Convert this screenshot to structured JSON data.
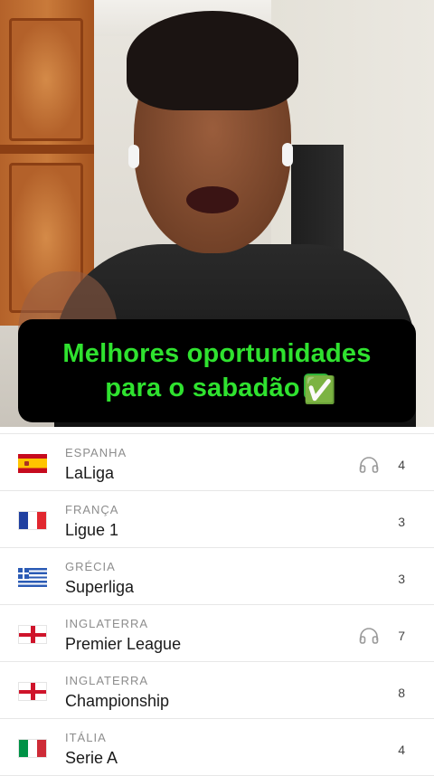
{
  "caption": {
    "line1": "Melhores oportunidades",
    "line2": "para o sabadão",
    "emoji": "✅"
  },
  "colors": {
    "caption_text": "#2fe22f",
    "caption_bg": "#000000"
  },
  "leagues": [
    {
      "country": "ESPANHA",
      "name": "LaLiga",
      "count": "4",
      "flag": "spain-flag",
      "headphones": true
    },
    {
      "country": "FRANÇA",
      "name": "Ligue 1",
      "count": "3",
      "flag": "france-flag",
      "headphones": false
    },
    {
      "country": "GRÉCIA",
      "name": "Superliga",
      "count": "3",
      "flag": "greece-flag",
      "headphones": false
    },
    {
      "country": "INGLATERRA",
      "name": "Premier League",
      "count": "7",
      "flag": "england-flag",
      "headphones": true
    },
    {
      "country": "INGLATERRA",
      "name": "Championship",
      "count": "8",
      "flag": "england-flag",
      "headphones": false
    },
    {
      "country": "ITÁLIA",
      "name": "Serie A",
      "count": "4",
      "flag": "italy-flag",
      "headphones": false
    }
  ]
}
